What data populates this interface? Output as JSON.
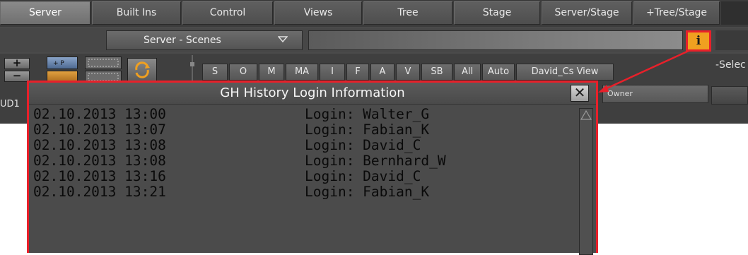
{
  "tabs": [
    {
      "label": "Server",
      "active": true
    },
    {
      "label": "Built Ins",
      "active": false
    },
    {
      "label": "Control",
      "active": false
    },
    {
      "label": "Views",
      "active": false
    },
    {
      "label": "Tree",
      "active": false
    },
    {
      "label": "Stage",
      "active": false
    },
    {
      "label": "Server/Stage",
      "active": false
    },
    {
      "label": "+Tree/Stage",
      "active": false
    }
  ],
  "scene_selector": {
    "label": "Server - Scenes",
    "icon": "chevron-down-icon"
  },
  "info_button": {
    "label": "i",
    "accent": "#f0a020",
    "highlight": "#e8202a"
  },
  "toolbar": {
    "plus_label": "+",
    "minus_label": "−",
    "filter_buttons": [
      "S",
      "O",
      "M",
      "MA",
      "I",
      "F",
      "A",
      "V",
      "SB",
      "All",
      "Auto",
      "David_Cs View"
    ],
    "right_label": "-Selec",
    "owner_header": "Owner",
    "left_clip": "UD1"
  },
  "dialog": {
    "title": "GH History Login Information",
    "close_label": "✕",
    "entries": [
      {
        "timestamp": "02.10.2013 13:00",
        "login": "Login: Walter_G"
      },
      {
        "timestamp": "02.10.2013 13:07",
        "login": "Login: Fabian_K"
      },
      {
        "timestamp": "02.10.2013 13:08",
        "login": "Login: David_C"
      },
      {
        "timestamp": "02.10.2013 13:08",
        "login": "Login: Bernhard_W"
      },
      {
        "timestamp": "02.10.2013 13:16",
        "login": "Login: David_C"
      },
      {
        "timestamp": "02.10.2013 13:21",
        "login": "Login: Fabian_K"
      }
    ]
  }
}
